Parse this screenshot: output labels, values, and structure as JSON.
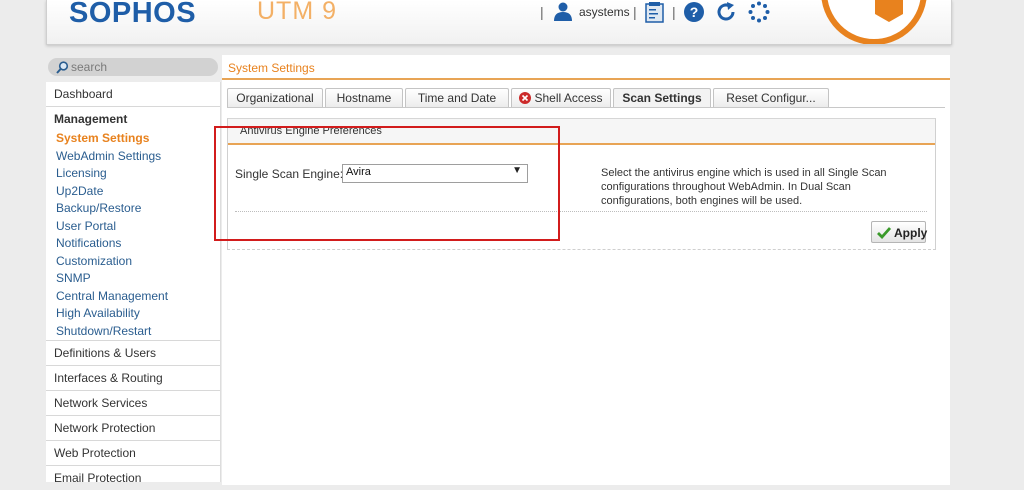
{
  "header": {
    "brand": "SOPHOS",
    "product": "UTM 9",
    "separator": "|",
    "username": "asystems",
    "icons": [
      "user-icon",
      "notes-icon",
      "help-icon",
      "refresh-icon",
      "activity-icon"
    ]
  },
  "search": {
    "placeholder": "search"
  },
  "sidebar": {
    "dashboard": "Dashboard",
    "management": {
      "title": "Management",
      "items": [
        {
          "label": "System Settings",
          "active": true
        },
        {
          "label": "WebAdmin Settings"
        },
        {
          "label": "Licensing"
        },
        {
          "label": "Up2Date"
        },
        {
          "label": "Backup/Restore"
        },
        {
          "label": "User Portal"
        },
        {
          "label": "Notifications"
        },
        {
          "label": "Customization"
        },
        {
          "label": "SNMP"
        },
        {
          "label": "Central Management"
        },
        {
          "label": "High Availability"
        },
        {
          "label": "Shutdown/Restart"
        }
      ]
    },
    "sections": [
      "Definitions & Users",
      "Interfaces & Routing",
      "Network Services",
      "Network Protection",
      "Web Protection",
      "Email Protection"
    ]
  },
  "main": {
    "page_title": "System Settings",
    "tabs": [
      {
        "label": "Organizational"
      },
      {
        "label": "Hostname"
      },
      {
        "label": "Time and Date"
      },
      {
        "label": "Shell Access",
        "icon": "error-x-icon"
      },
      {
        "label": "Scan Settings",
        "active": true
      },
      {
        "label": "Reset Configur..."
      }
    ],
    "panel": {
      "title": "Antivirus Engine Preferences",
      "engine_label": "Single Scan Engine:",
      "engine_value": "Avira",
      "help_text": "Select the antivirus engine which is used in all Single Scan configurations throughout WebAdmin. In Dual Scan configurations, both engines will be used.",
      "apply_label": "Apply"
    }
  },
  "colors": {
    "brand_blue": "#1f5ea8",
    "accent_orange": "#e8821e",
    "link_blue": "#2a5d8f",
    "highlight_red": "#d21c1c"
  }
}
